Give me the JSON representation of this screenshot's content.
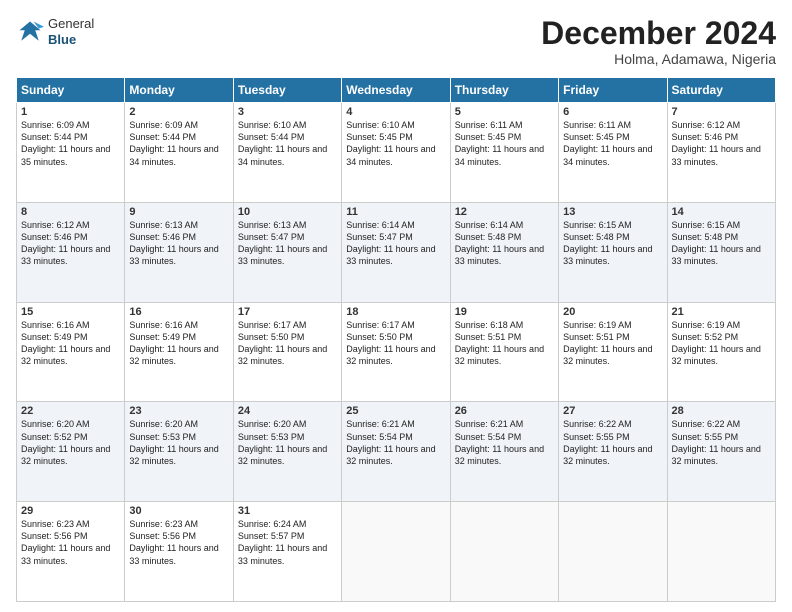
{
  "logo": {
    "general": "General",
    "blue": "Blue"
  },
  "title": "December 2024",
  "location": "Holma, Adamawa, Nigeria",
  "days_of_week": [
    "Sunday",
    "Monday",
    "Tuesday",
    "Wednesday",
    "Thursday",
    "Friday",
    "Saturday"
  ],
  "weeks": [
    [
      {
        "day": "1",
        "sunrise": "6:09 AM",
        "sunset": "5:44 PM",
        "daylight": "11 hours and 35 minutes."
      },
      {
        "day": "2",
        "sunrise": "6:09 AM",
        "sunset": "5:44 PM",
        "daylight": "11 hours and 34 minutes."
      },
      {
        "day": "3",
        "sunrise": "6:10 AM",
        "sunset": "5:44 PM",
        "daylight": "11 hours and 34 minutes."
      },
      {
        "day": "4",
        "sunrise": "6:10 AM",
        "sunset": "5:45 PM",
        "daylight": "11 hours and 34 minutes."
      },
      {
        "day": "5",
        "sunrise": "6:11 AM",
        "sunset": "5:45 PM",
        "daylight": "11 hours and 34 minutes."
      },
      {
        "day": "6",
        "sunrise": "6:11 AM",
        "sunset": "5:45 PM",
        "daylight": "11 hours and 34 minutes."
      },
      {
        "day": "7",
        "sunrise": "6:12 AM",
        "sunset": "5:46 PM",
        "daylight": "11 hours and 33 minutes."
      }
    ],
    [
      {
        "day": "8",
        "sunrise": "6:12 AM",
        "sunset": "5:46 PM",
        "daylight": "11 hours and 33 minutes."
      },
      {
        "day": "9",
        "sunrise": "6:13 AM",
        "sunset": "5:46 PM",
        "daylight": "11 hours and 33 minutes."
      },
      {
        "day": "10",
        "sunrise": "6:13 AM",
        "sunset": "5:47 PM",
        "daylight": "11 hours and 33 minutes."
      },
      {
        "day": "11",
        "sunrise": "6:14 AM",
        "sunset": "5:47 PM",
        "daylight": "11 hours and 33 minutes."
      },
      {
        "day": "12",
        "sunrise": "6:14 AM",
        "sunset": "5:48 PM",
        "daylight": "11 hours and 33 minutes."
      },
      {
        "day": "13",
        "sunrise": "6:15 AM",
        "sunset": "5:48 PM",
        "daylight": "11 hours and 33 minutes."
      },
      {
        "day": "14",
        "sunrise": "6:15 AM",
        "sunset": "5:48 PM",
        "daylight": "11 hours and 33 minutes."
      }
    ],
    [
      {
        "day": "15",
        "sunrise": "6:16 AM",
        "sunset": "5:49 PM",
        "daylight": "11 hours and 32 minutes."
      },
      {
        "day": "16",
        "sunrise": "6:16 AM",
        "sunset": "5:49 PM",
        "daylight": "11 hours and 32 minutes."
      },
      {
        "day": "17",
        "sunrise": "6:17 AM",
        "sunset": "5:50 PM",
        "daylight": "11 hours and 32 minutes."
      },
      {
        "day": "18",
        "sunrise": "6:17 AM",
        "sunset": "5:50 PM",
        "daylight": "11 hours and 32 minutes."
      },
      {
        "day": "19",
        "sunrise": "6:18 AM",
        "sunset": "5:51 PM",
        "daylight": "11 hours and 32 minutes."
      },
      {
        "day": "20",
        "sunrise": "6:19 AM",
        "sunset": "5:51 PM",
        "daylight": "11 hours and 32 minutes."
      },
      {
        "day": "21",
        "sunrise": "6:19 AM",
        "sunset": "5:52 PM",
        "daylight": "11 hours and 32 minutes."
      }
    ],
    [
      {
        "day": "22",
        "sunrise": "6:20 AM",
        "sunset": "5:52 PM",
        "daylight": "11 hours and 32 minutes."
      },
      {
        "day": "23",
        "sunrise": "6:20 AM",
        "sunset": "5:53 PM",
        "daylight": "11 hours and 32 minutes."
      },
      {
        "day": "24",
        "sunrise": "6:20 AM",
        "sunset": "5:53 PM",
        "daylight": "11 hours and 32 minutes."
      },
      {
        "day": "25",
        "sunrise": "6:21 AM",
        "sunset": "5:54 PM",
        "daylight": "11 hours and 32 minutes."
      },
      {
        "day": "26",
        "sunrise": "6:21 AM",
        "sunset": "5:54 PM",
        "daylight": "11 hours and 32 minutes."
      },
      {
        "day": "27",
        "sunrise": "6:22 AM",
        "sunset": "5:55 PM",
        "daylight": "11 hours and 32 minutes."
      },
      {
        "day": "28",
        "sunrise": "6:22 AM",
        "sunset": "5:55 PM",
        "daylight": "11 hours and 32 minutes."
      }
    ],
    [
      {
        "day": "29",
        "sunrise": "6:23 AM",
        "sunset": "5:56 PM",
        "daylight": "11 hours and 33 minutes."
      },
      {
        "day": "30",
        "sunrise": "6:23 AM",
        "sunset": "5:56 PM",
        "daylight": "11 hours and 33 minutes."
      },
      {
        "day": "31",
        "sunrise": "6:24 AM",
        "sunset": "5:57 PM",
        "daylight": "11 hours and 33 minutes."
      },
      null,
      null,
      null,
      null
    ]
  ]
}
